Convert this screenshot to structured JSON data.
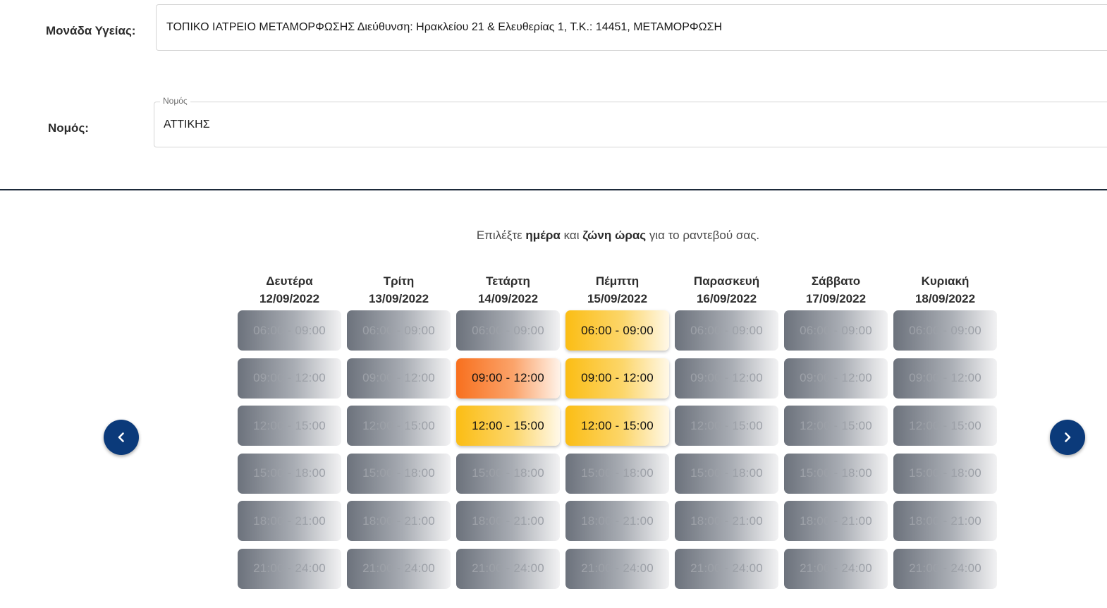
{
  "health_unit": {
    "label": "Μονάδα Υγείας:",
    "value": "ΤΟΠΙΚΟ ΙΑΤΡΕΙΟ ΜΕΤΑΜΟΡΦΩΣΗΣ Διεύθυνση: Ηρακλείου 21 & Ελευθερίας 1, Τ.Κ.: 14451, ΜΕΤΑΜΟΡΦΩΣΗ"
  },
  "prefecture": {
    "label": "Νομός:",
    "floating_label": "Νομός",
    "value": "ΑΤΤΙΚΗΣ"
  },
  "instruction": {
    "prefix": "Επιλέξτε ",
    "bold1": "ημέρα",
    "middle": " και ",
    "bold2": "ζώνη ώρας",
    "suffix": " για το ραντεβού σας."
  },
  "schedule": {
    "days": [
      {
        "name": "Δευτέρα",
        "date": "12/09/2022",
        "slots": [
          {
            "time": "06:00 - 09:00",
            "state": "disabled"
          },
          {
            "time": "09:00 - 12:00",
            "state": "disabled"
          },
          {
            "time": "12:00 - 15:00",
            "state": "disabled"
          },
          {
            "time": "15:00 - 18:00",
            "state": "disabled"
          },
          {
            "time": "18:00 - 21:00",
            "state": "disabled"
          },
          {
            "time": "21:00 - 24:00",
            "state": "disabled"
          }
        ]
      },
      {
        "name": "Τρίτη",
        "date": "13/09/2022",
        "slots": [
          {
            "time": "06:00 - 09:00",
            "state": "disabled"
          },
          {
            "time": "09:00 - 12:00",
            "state": "disabled"
          },
          {
            "time": "12:00 - 15:00",
            "state": "disabled"
          },
          {
            "time": "15:00 - 18:00",
            "state": "disabled"
          },
          {
            "time": "18:00 - 21:00",
            "state": "disabled"
          },
          {
            "time": "21:00 - 24:00",
            "state": "disabled"
          }
        ]
      },
      {
        "name": "Τετάρτη",
        "date": "14/09/2022",
        "slots": [
          {
            "time": "06:00 - 09:00",
            "state": "disabled"
          },
          {
            "time": "09:00 - 12:00",
            "state": "selected"
          },
          {
            "time": "12:00 - 15:00",
            "state": "available"
          },
          {
            "time": "15:00 - 18:00",
            "state": "disabled"
          },
          {
            "time": "18:00 - 21:00",
            "state": "disabled"
          },
          {
            "time": "21:00 - 24:00",
            "state": "disabled"
          }
        ]
      },
      {
        "name": "Πέμπτη",
        "date": "15/09/2022",
        "slots": [
          {
            "time": "06:00 - 09:00",
            "state": "available"
          },
          {
            "time": "09:00 - 12:00",
            "state": "available"
          },
          {
            "time": "12:00 - 15:00",
            "state": "available"
          },
          {
            "time": "15:00 - 18:00",
            "state": "disabled"
          },
          {
            "time": "18:00 - 21:00",
            "state": "disabled"
          },
          {
            "time": "21:00 - 24:00",
            "state": "disabled"
          }
        ]
      },
      {
        "name": "Παρασκευή",
        "date": "16/09/2022",
        "slots": [
          {
            "time": "06:00 - 09:00",
            "state": "disabled"
          },
          {
            "time": "09:00 - 12:00",
            "state": "disabled"
          },
          {
            "time": "12:00 - 15:00",
            "state": "disabled"
          },
          {
            "time": "15:00 - 18:00",
            "state": "disabled"
          },
          {
            "time": "18:00 - 21:00",
            "state": "disabled"
          },
          {
            "time": "21:00 - 24:00",
            "state": "disabled"
          }
        ]
      },
      {
        "name": "Σάββατο",
        "date": "17/09/2022",
        "slots": [
          {
            "time": "06:00 - 09:00",
            "state": "disabled"
          },
          {
            "time": "09:00 - 12:00",
            "state": "disabled"
          },
          {
            "time": "12:00 - 15:00",
            "state": "disabled"
          },
          {
            "time": "15:00 - 18:00",
            "state": "disabled"
          },
          {
            "time": "18:00 - 21:00",
            "state": "disabled"
          },
          {
            "time": "21:00 - 24:00",
            "state": "disabled"
          }
        ]
      },
      {
        "name": "Κυριακή",
        "date": "18/09/2022",
        "slots": [
          {
            "time": "06:00 - 09:00",
            "state": "disabled"
          },
          {
            "time": "09:00 - 12:00",
            "state": "disabled"
          },
          {
            "time": "12:00 - 15:00",
            "state": "disabled"
          },
          {
            "time": "15:00 - 18:00",
            "state": "disabled"
          },
          {
            "time": "18:00 - 21:00",
            "state": "disabled"
          },
          {
            "time": "21:00 - 24:00",
            "state": "disabled"
          }
        ]
      }
    ]
  },
  "navigation": {
    "prev_icon": "chevron-left-icon",
    "next_icon": "chevron-right-icon"
  },
  "colors": {
    "nav_button": "#0b3a7a",
    "available_slot": "#fbbd14",
    "selected_slot": "#f8701e",
    "disabled_slot": "#6c727c",
    "divider": "#1d2a3a"
  }
}
